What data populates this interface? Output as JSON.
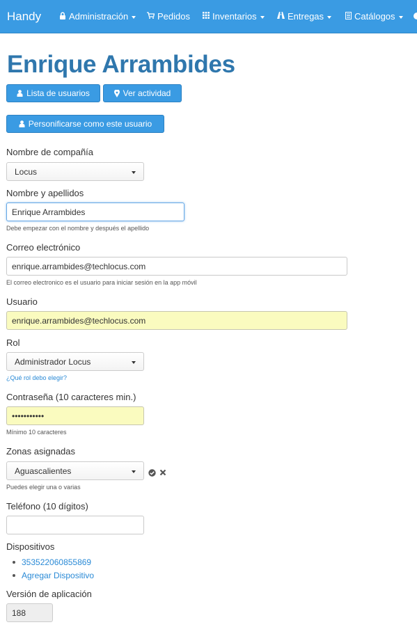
{
  "navbar": {
    "brand": "Handy",
    "items": [
      {
        "label": "Administración",
        "icon": "lock-icon"
      },
      {
        "label": "Pedidos",
        "icon": "cart-icon"
      },
      {
        "label": "Inventarios",
        "icon": "grid-icon"
      },
      {
        "label": "Entregas",
        "icon": "road-icon"
      },
      {
        "label": "Catálogos",
        "icon": "list-icon"
      }
    ],
    "color": "#3a9be3"
  },
  "page": {
    "title": "Enrique Arrambides",
    "title_color": "#2f77ad"
  },
  "buttons": {
    "user_list": "Lista de usuarios",
    "view_activity": "Ver actividad",
    "impersonate": "Personificarse como este usuario"
  },
  "form": {
    "company": {
      "label": "Nombre de compañía",
      "value": "Locus"
    },
    "name": {
      "label": "Nombre y apellidos",
      "value": "Enrique Arrambides",
      "help": "Debe empezar con el nombre y después el apellido"
    },
    "email": {
      "label": "Correo electrónico",
      "value": "enrique.arrambides@techlocus.com",
      "help": "El correo electronico es el usuario para iniciar sesión en la app móvil"
    },
    "username": {
      "label": "Usuario",
      "value": "enrique.arrambides@techlocus.com"
    },
    "role": {
      "label": "Rol",
      "value": "Administrador Locus",
      "help": "¿Qué rol debo elegir?"
    },
    "password": {
      "label": "Contraseña (10 caracteres min.)",
      "value": "•••••••••••",
      "help": "Mínimo 10 caracteres"
    },
    "zones": {
      "label": "Zonas asignadas",
      "value": "Aguascalientes",
      "help": "Puedes elegir una o varias"
    },
    "phone": {
      "label": "Teléfono (10 dígitos)",
      "value": ""
    },
    "devices": {
      "label": "Dispositivos",
      "items": [
        "353522060855869",
        "Agregar Dispositivo"
      ]
    },
    "app_version": {
      "label": "Versión de aplicación",
      "value": "188"
    }
  }
}
